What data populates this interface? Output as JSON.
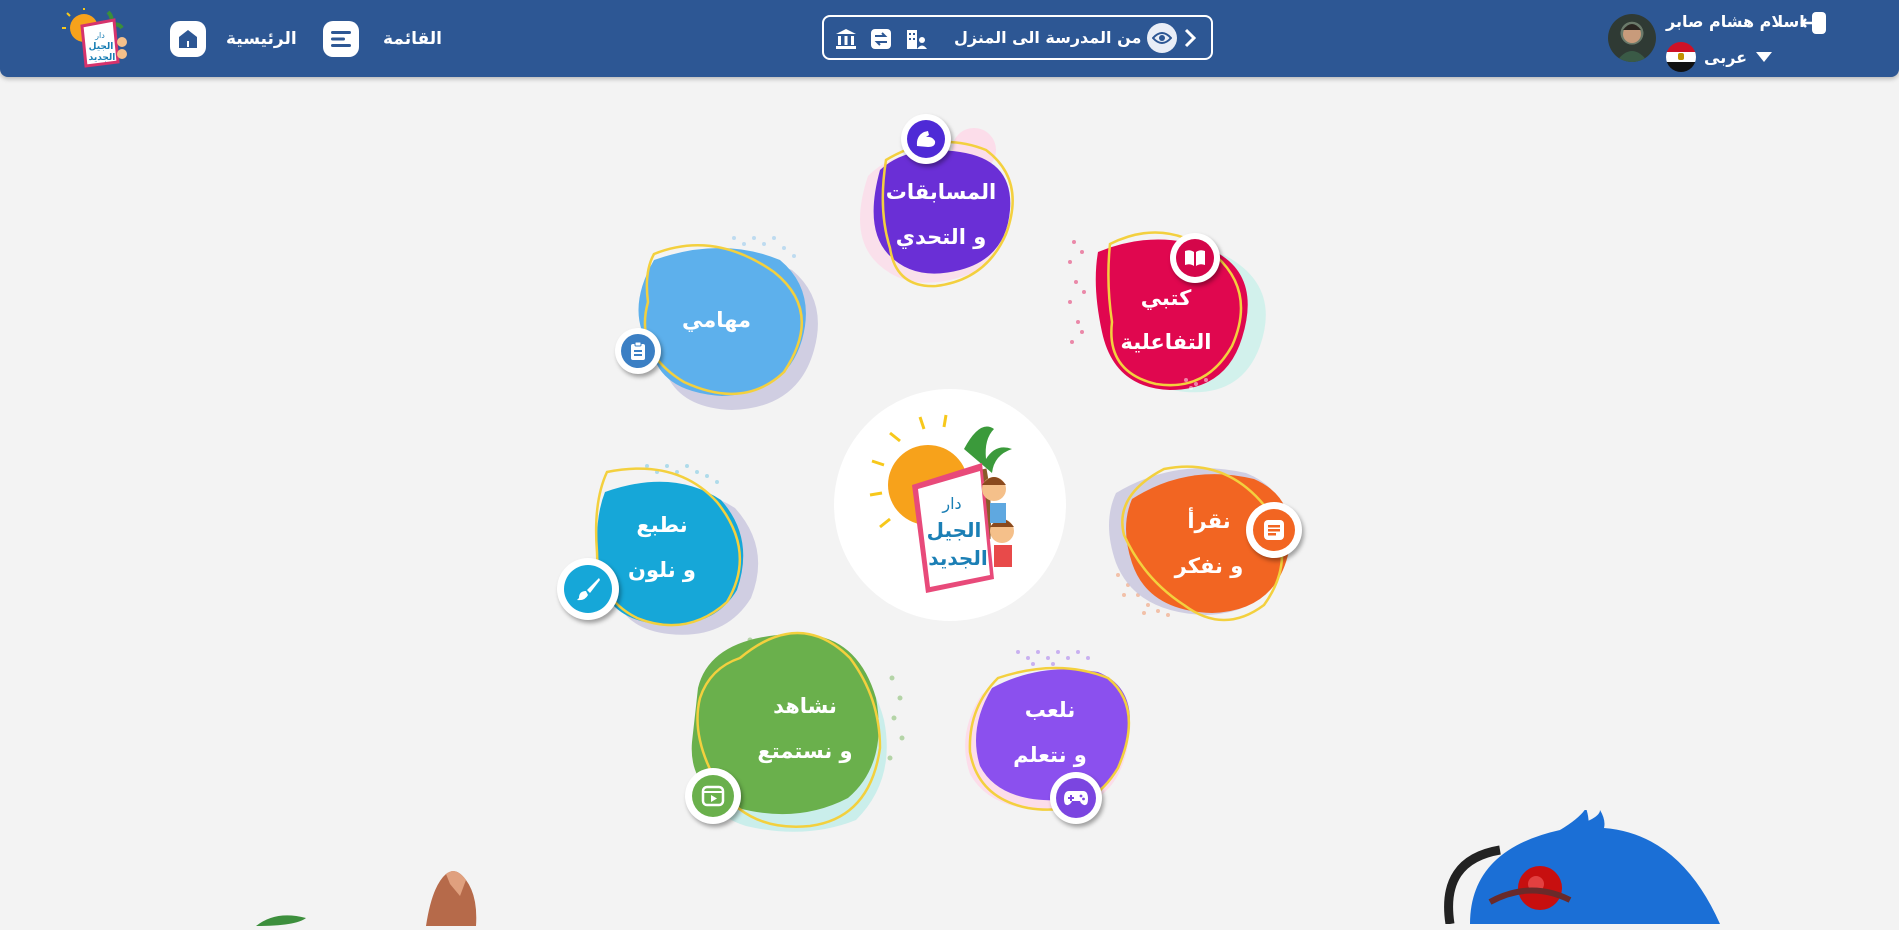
{
  "header": {
    "nav_home_label": "الرئيسية",
    "nav_menu_label": "القائمة",
    "school_title": "من المدرسة الى المنزل",
    "user_name": "اسلام هشام صابر",
    "language": "عربى"
  },
  "center_logo_text": [
    "دار",
    "الجيل",
    "الجديد"
  ],
  "tiles": {
    "competitions": {
      "line1": "المسابقات",
      "line2": "و التحدي",
      "color": "#6a2fd6"
    },
    "books": {
      "line1": "كتبي",
      "line2": "التفاعلية",
      "color": "#e0074f"
    },
    "tasks": {
      "line1": "مهامي",
      "color": "#5db0ec"
    },
    "read": {
      "line1": "نقرأ",
      "line2": "و نفكر",
      "color": "#f26522"
    },
    "print": {
      "line1": "نطبع",
      "line2": "و نلون",
      "color": "#16a7d8"
    },
    "watch": {
      "line1": "نشاهد",
      "line2": "و نستمتع",
      "color": "#6ab04c"
    },
    "play": {
      "line1": "نلعب",
      "line2": "و نتعلم",
      "color": "#8b50ee"
    }
  },
  "colors": {
    "header_bg": "#2d5794",
    "page_bg": "#f3f3f3"
  }
}
